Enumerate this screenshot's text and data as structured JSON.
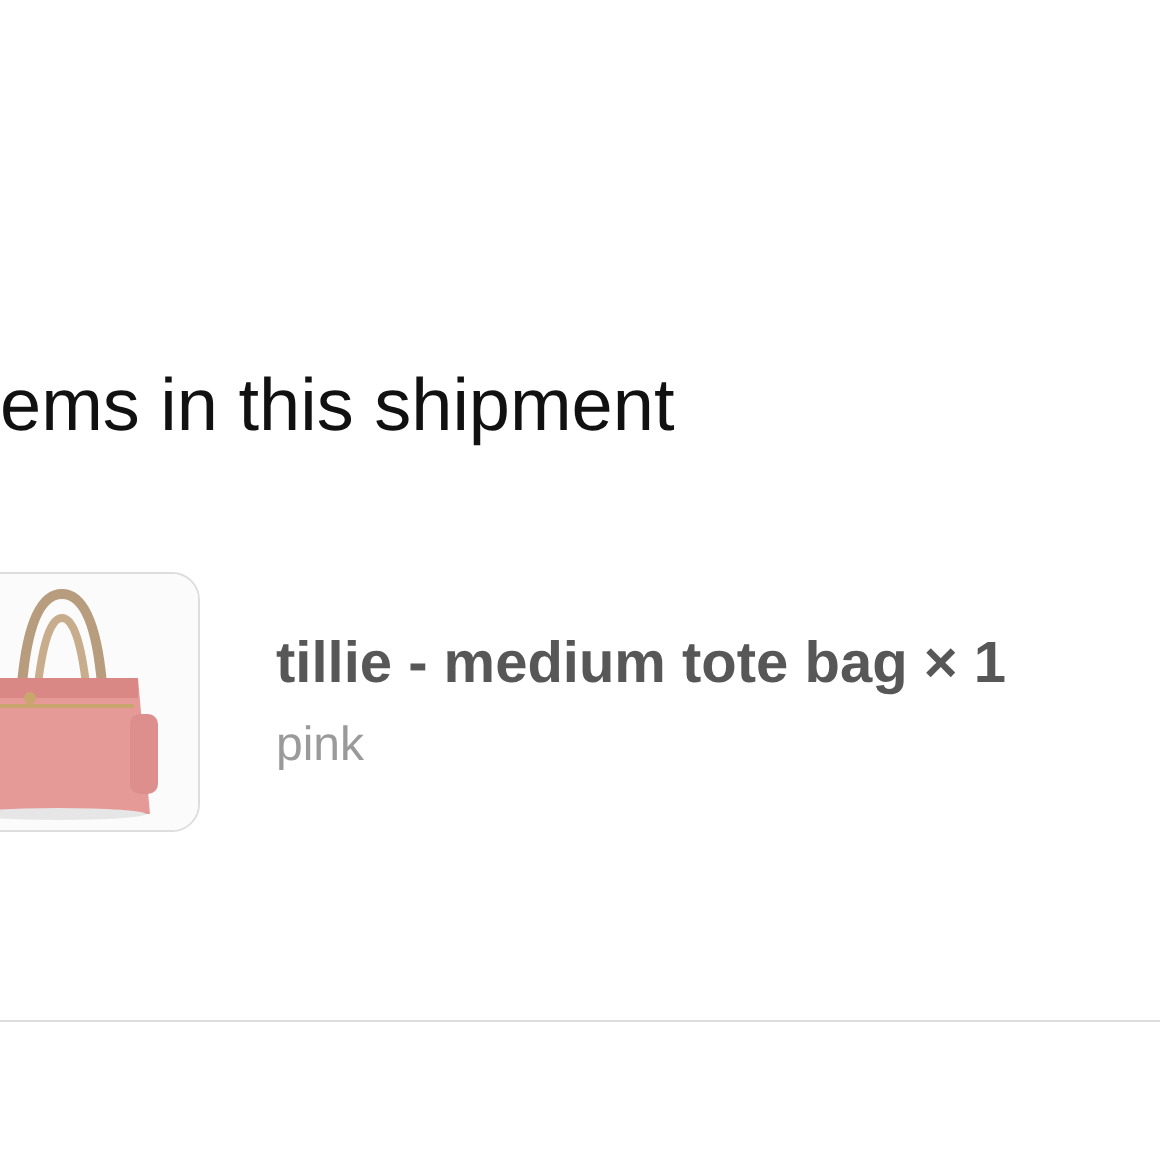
{
  "section": {
    "title": "ems in this shipment"
  },
  "items": [
    {
      "name": "tillie - medium tote bag × 1",
      "variant": "pink"
    }
  ]
}
